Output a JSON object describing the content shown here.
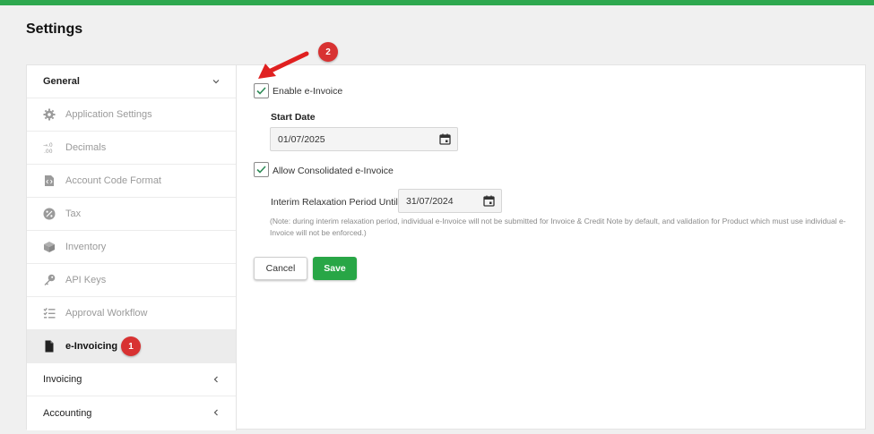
{
  "header": {
    "title": "Settings"
  },
  "sidebar": {
    "general_label": "General",
    "items": [
      {
        "label": "Application Settings",
        "icon": "gear-icon"
      },
      {
        "label": "Decimals",
        "icon": "decimals-icon"
      },
      {
        "label": "Account Code Format",
        "icon": "code-file-icon"
      },
      {
        "label": "Tax",
        "icon": "percent-icon"
      },
      {
        "label": "Inventory",
        "icon": "box-icon"
      },
      {
        "label": "API Keys",
        "icon": "key-icon"
      },
      {
        "label": "Approval Workflow",
        "icon": "checklist-icon"
      },
      {
        "label": "e-Invoicing",
        "icon": "document-icon",
        "active": true
      }
    ],
    "invoicing_label": "Invoicing",
    "accounting_label": "Accounting"
  },
  "einvoice": {
    "enable_label": "Enable e-Invoice",
    "enable_checked": true,
    "start_date_label": "Start Date",
    "start_date_value": "01/07/2025",
    "consolidated_label": "Allow Consolidated e-Invoice",
    "consolidated_checked": true,
    "interim_label": "Interim Relaxation Period Until",
    "interim_value": "31/07/2024",
    "note": "(Note: during interim relaxation period, individual e-Invoice will not be submitted for Invoice & Credit Note by default, and validation for Product which must use individual e-Invoice will not be enforced.)"
  },
  "actions": {
    "cancel_label": "Cancel",
    "save_label": "Save"
  },
  "annotations": {
    "badge_1": "1",
    "badge_2": "2"
  },
  "colors": {
    "accent_green": "#28a646",
    "top_bar": "#2ea84f",
    "badge_red": "#d83232"
  }
}
